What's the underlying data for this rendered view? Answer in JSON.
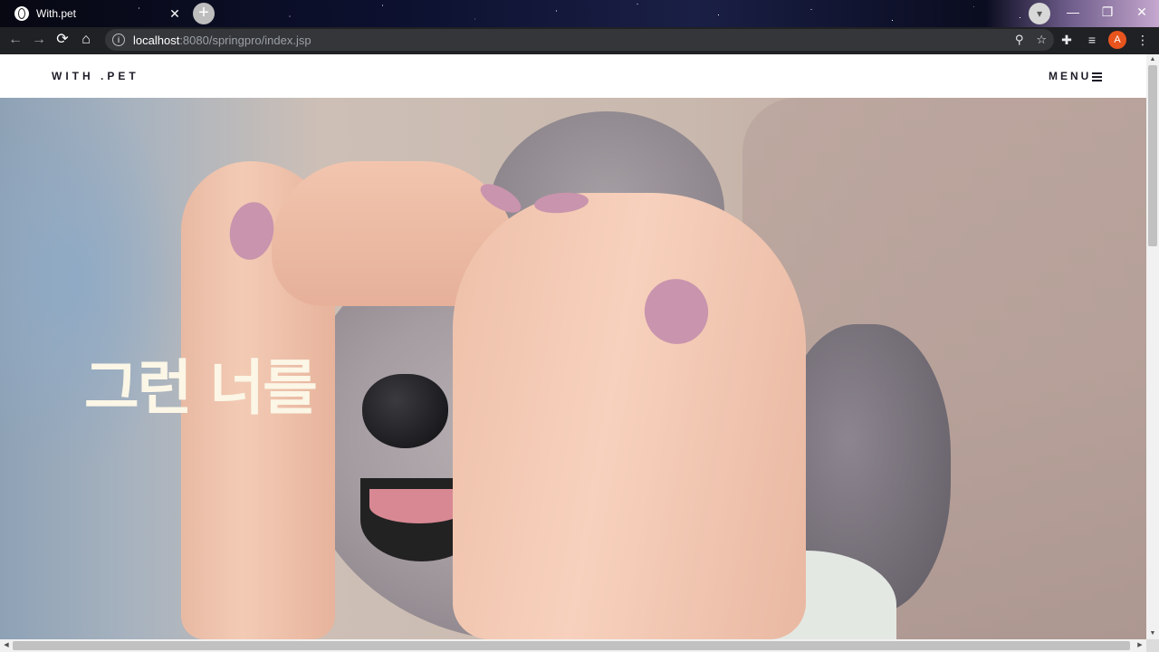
{
  "browser": {
    "tab": {
      "title": "With.pet",
      "close": "✕"
    },
    "new_tab": "+",
    "window_controls": [
      "—",
      "❐",
      "✕"
    ],
    "nav": {
      "back": "←",
      "forward": "→",
      "reload": "⟳",
      "home": "⌂"
    },
    "address": {
      "host": "localhost",
      "path": ":8080/springpro/index.jsp"
    },
    "profile_initial": "A"
  },
  "site": {
    "logo": "WITH .PET",
    "menu_label": "MENU",
    "hero_text": "그런 너를"
  }
}
